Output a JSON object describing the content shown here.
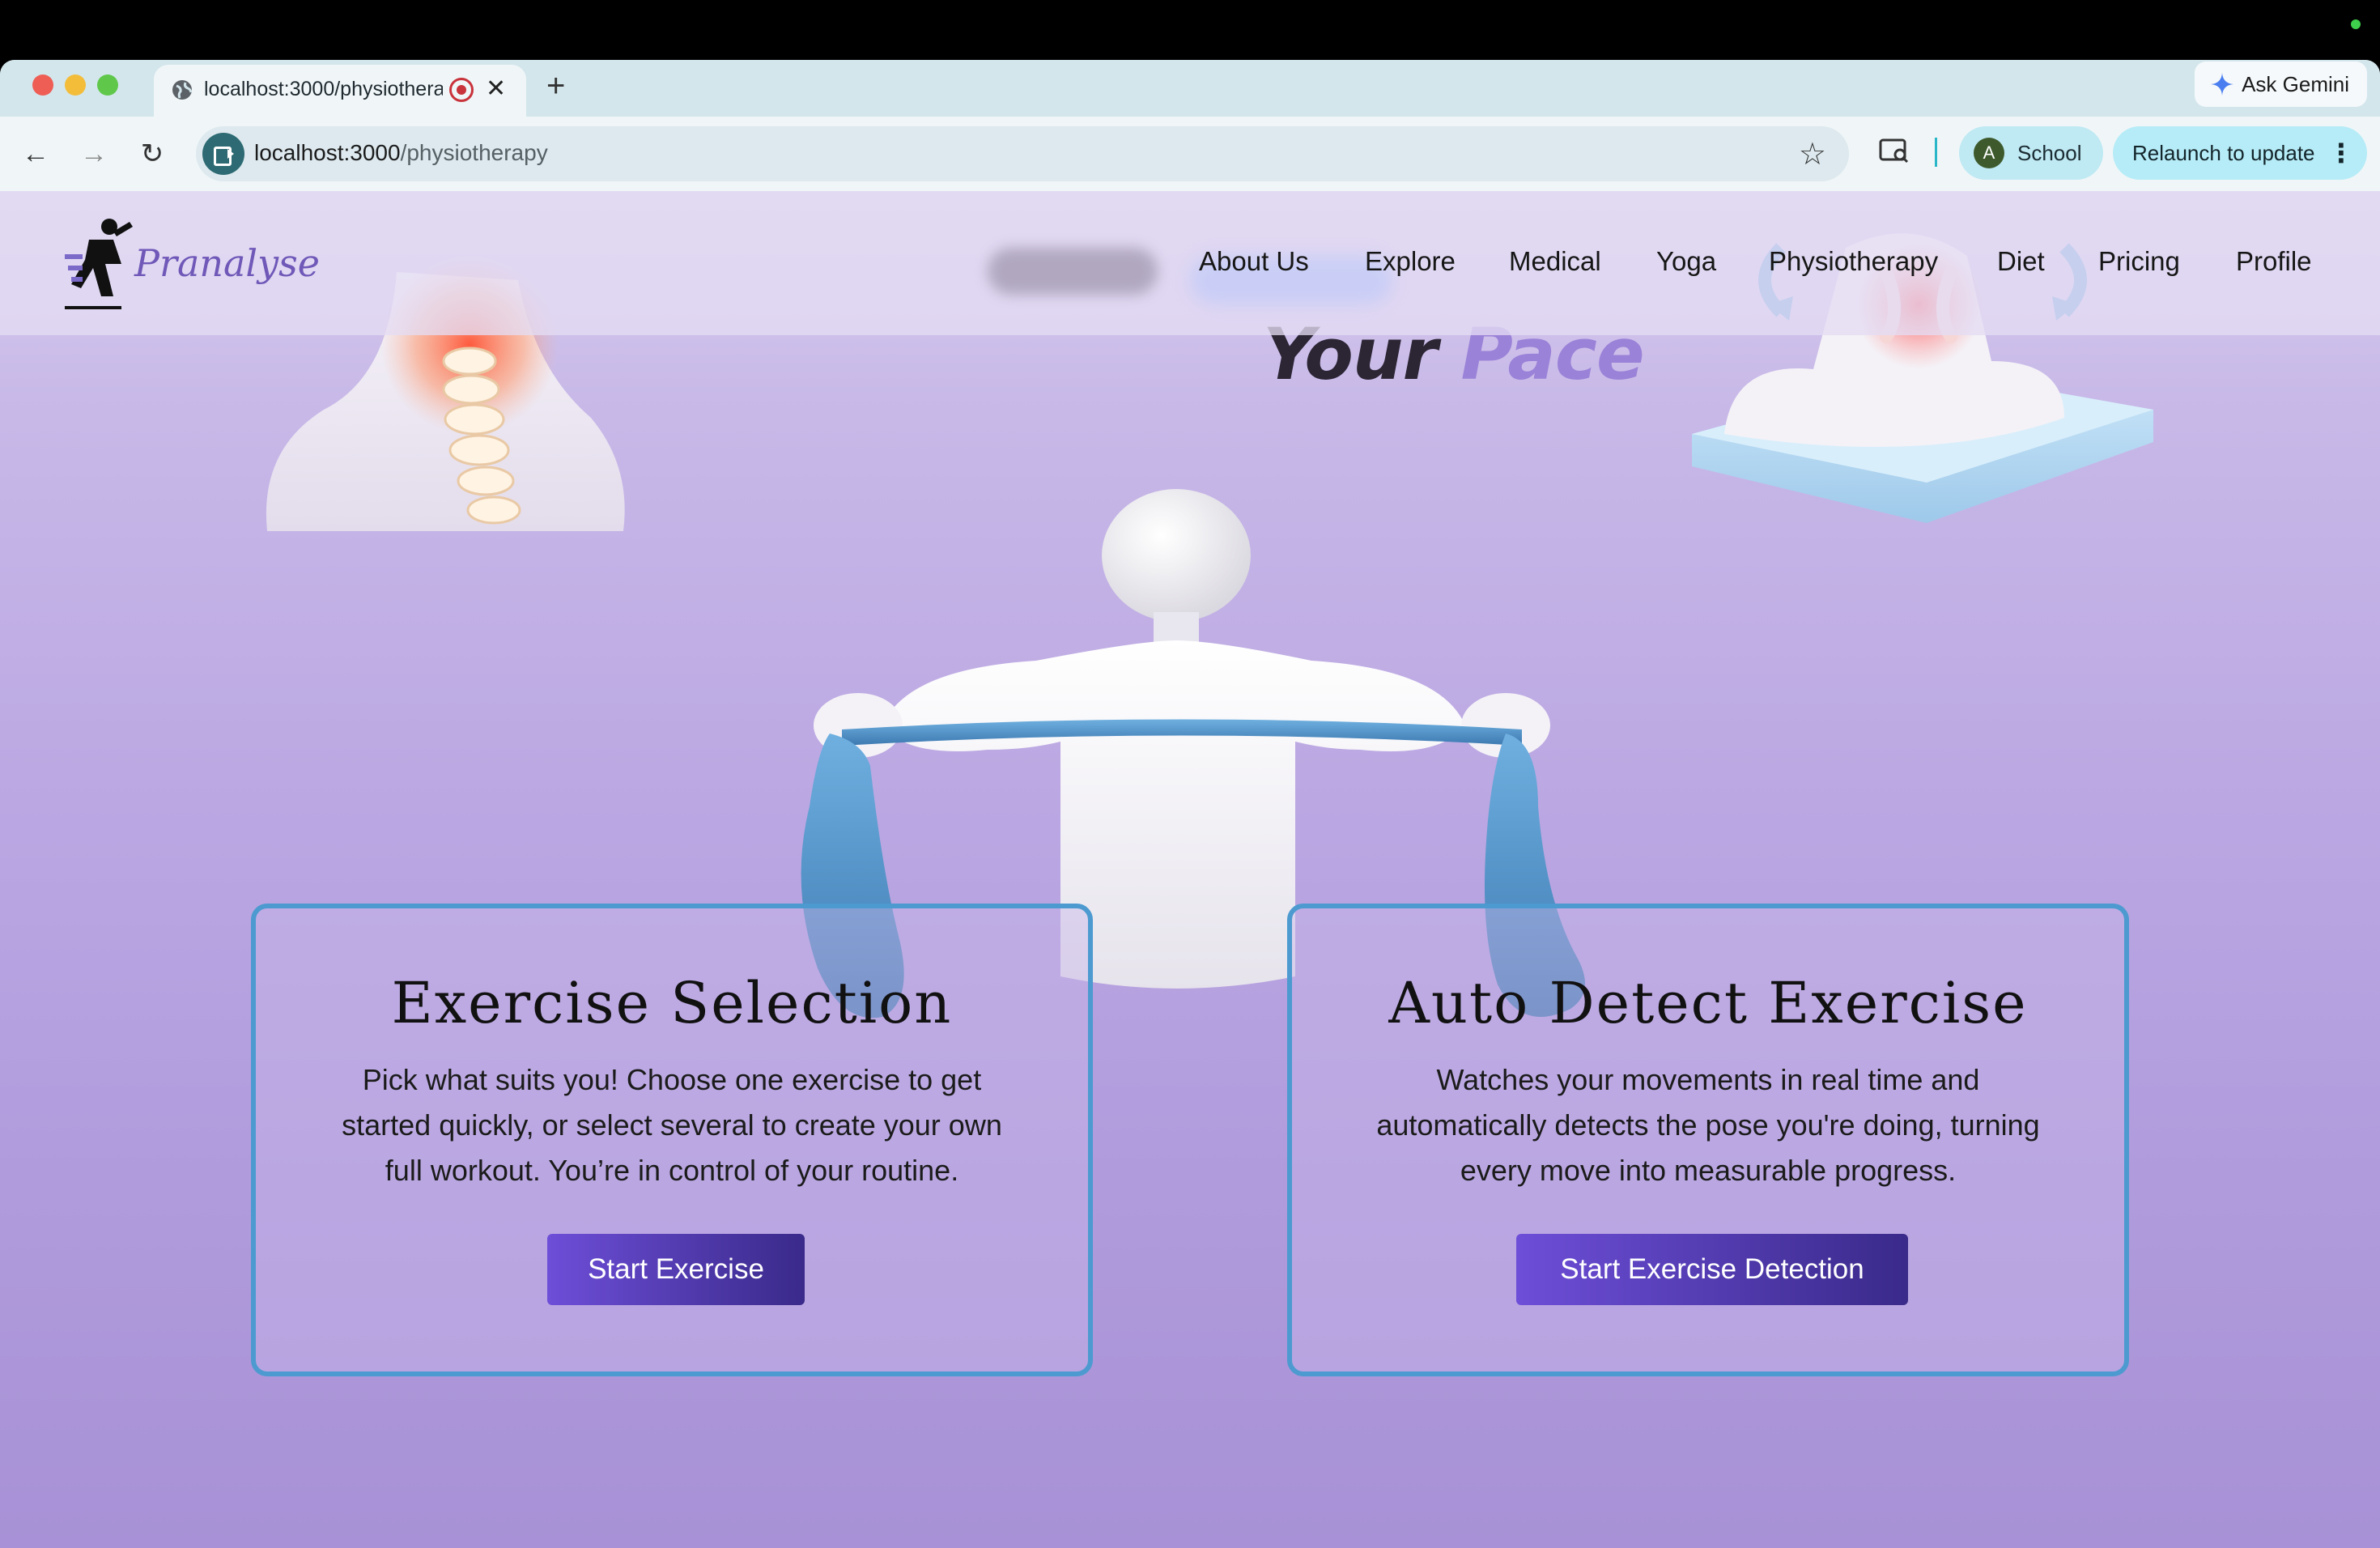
{
  "browser": {
    "tab_title": "localhost:3000/physiotherapy",
    "ask_gemini": "Ask Gemini",
    "url_host": "localhost:3000",
    "url_path": "/physiotherapy",
    "profile_label": "School",
    "profile_avatar": "A",
    "relaunch_label": "Relaunch to update"
  },
  "site": {
    "brand": "Pranalyse",
    "nav": [
      "About Us",
      "Explore",
      "Medical",
      "Yoga",
      "Physiotherapy",
      "Diet",
      "Pricing",
      "Profile"
    ]
  },
  "hero": {
    "title_part1": "Your",
    "title_part2": "Pace"
  },
  "cards": [
    {
      "title": "Exercise Selection",
      "description": "Pick what suits you! Choose one exercise to get started quickly, or select several to create your own full workout. You’re in control of your routine.",
      "button": "Start Exercise"
    },
    {
      "title": "Auto Detect Exercise",
      "description": "Watches your movements in real time and automatically detects the pose you're doing, turning every move into measurable progress.",
      "button": "Start Exercise Detection"
    }
  ],
  "colors": {
    "accent_purple": "#9a82d8",
    "button_gradient_start": "#6d4ed8",
    "button_gradient_end": "#3a2a8a",
    "card_border": "#4c9ad0"
  }
}
